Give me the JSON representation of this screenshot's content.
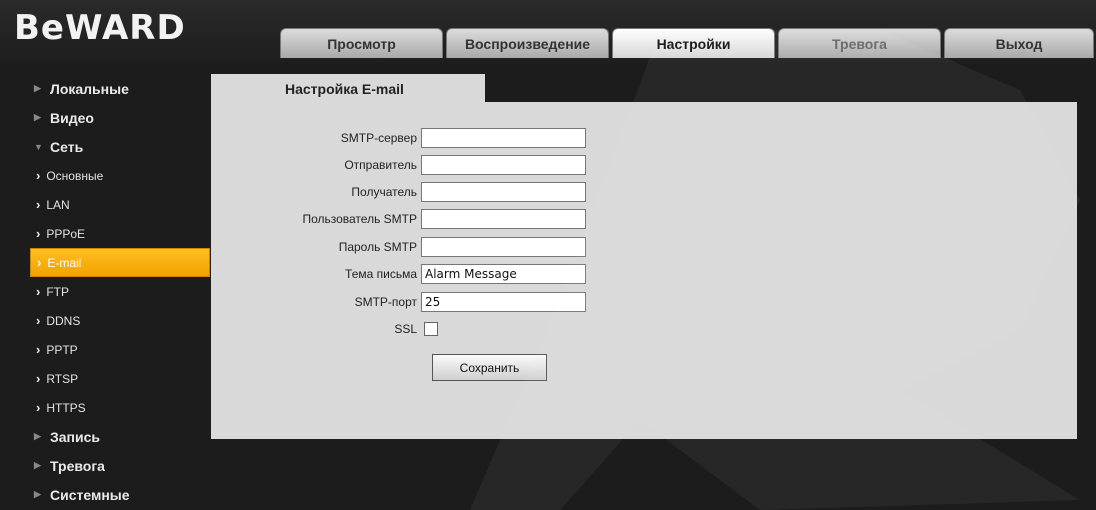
{
  "header": {
    "logo": "BeWARD",
    "tabs": [
      {
        "label": "Просмотр"
      },
      {
        "label": "Воспроизведение"
      },
      {
        "label": "Настройки",
        "active": true
      },
      {
        "label": "Тревога"
      },
      {
        "label": "Выход"
      }
    ]
  },
  "sidebar": {
    "items": [
      {
        "label": "Локальные"
      },
      {
        "label": "Видео"
      },
      {
        "label": "Сеть",
        "expanded": true
      },
      {
        "label": "Запись"
      },
      {
        "label": "Тревога"
      },
      {
        "label": "Системные"
      }
    ],
    "network_subitems": [
      {
        "label": "Основные"
      },
      {
        "label": "LAN"
      },
      {
        "label": "PPPoE"
      },
      {
        "label": "E-mail",
        "selected": true
      },
      {
        "label": "FTP"
      },
      {
        "label": "DDNS"
      },
      {
        "label": "PPTP"
      },
      {
        "label": "RTSP"
      },
      {
        "label": "HTTPS"
      }
    ]
  },
  "content": {
    "title": "Настройка E-mail",
    "fields": {
      "smtp_server": {
        "label": "SMTP-сервер",
        "value": ""
      },
      "sender": {
        "label": "Отправитель",
        "value": ""
      },
      "recipient": {
        "label": "Получатель",
        "value": ""
      },
      "smtp_user": {
        "label": "Пользователь SMTP",
        "value": ""
      },
      "smtp_password": {
        "label": "Пароль SMTP",
        "value": ""
      },
      "subject": {
        "label": "Тема письма",
        "value": "Alarm Message"
      },
      "smtp_port": {
        "label": "SMTP-порт",
        "value": "25"
      },
      "ssl": {
        "label": "SSL",
        "checked": false
      }
    },
    "save_label": "Сохранить"
  },
  "colors": {
    "accent": "#f7ac00",
    "background": "#1c1c1c",
    "panel": "#d9d9d9"
  }
}
